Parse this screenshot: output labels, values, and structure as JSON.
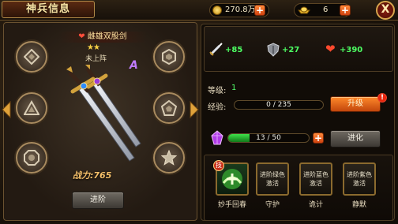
{
  "header": {
    "title": "神兵信息",
    "gold": "270.8万",
    "ingots": "6",
    "close_label": "X"
  },
  "weapon": {
    "name": "雌雄双股剑",
    "stars": "★★",
    "status": "未上阵",
    "grade": "A",
    "power_label": "战力:",
    "power_value": "765",
    "advance_button": "进阶"
  },
  "stats": {
    "attack": "+85",
    "defense": "+27",
    "hp": "+390"
  },
  "level": {
    "label": "等级:",
    "value": "1"
  },
  "experience": {
    "label": "经验:",
    "text": "0 / 235",
    "fraction": 0.0,
    "upgrade_button": "升级",
    "badge": "!"
  },
  "crystal": {
    "text": "13 / 50",
    "fraction": 0.26,
    "evolve_button": "进化"
  },
  "skills": [
    {
      "icon_text": "",
      "name": "妙手回春",
      "tag": "技"
    },
    {
      "icon_text": "进阶绿色\n激活",
      "name": "守护"
    },
    {
      "icon_text": "进阶蓝色\n激活",
      "name": "诡计"
    },
    {
      "icon_text": "进阶紫色\n激活",
      "name": "静默"
    }
  ],
  "colors": {
    "accent_orange": "#e2601a",
    "stat_green": "#4dff63",
    "grade_purple": "#c07bff"
  }
}
